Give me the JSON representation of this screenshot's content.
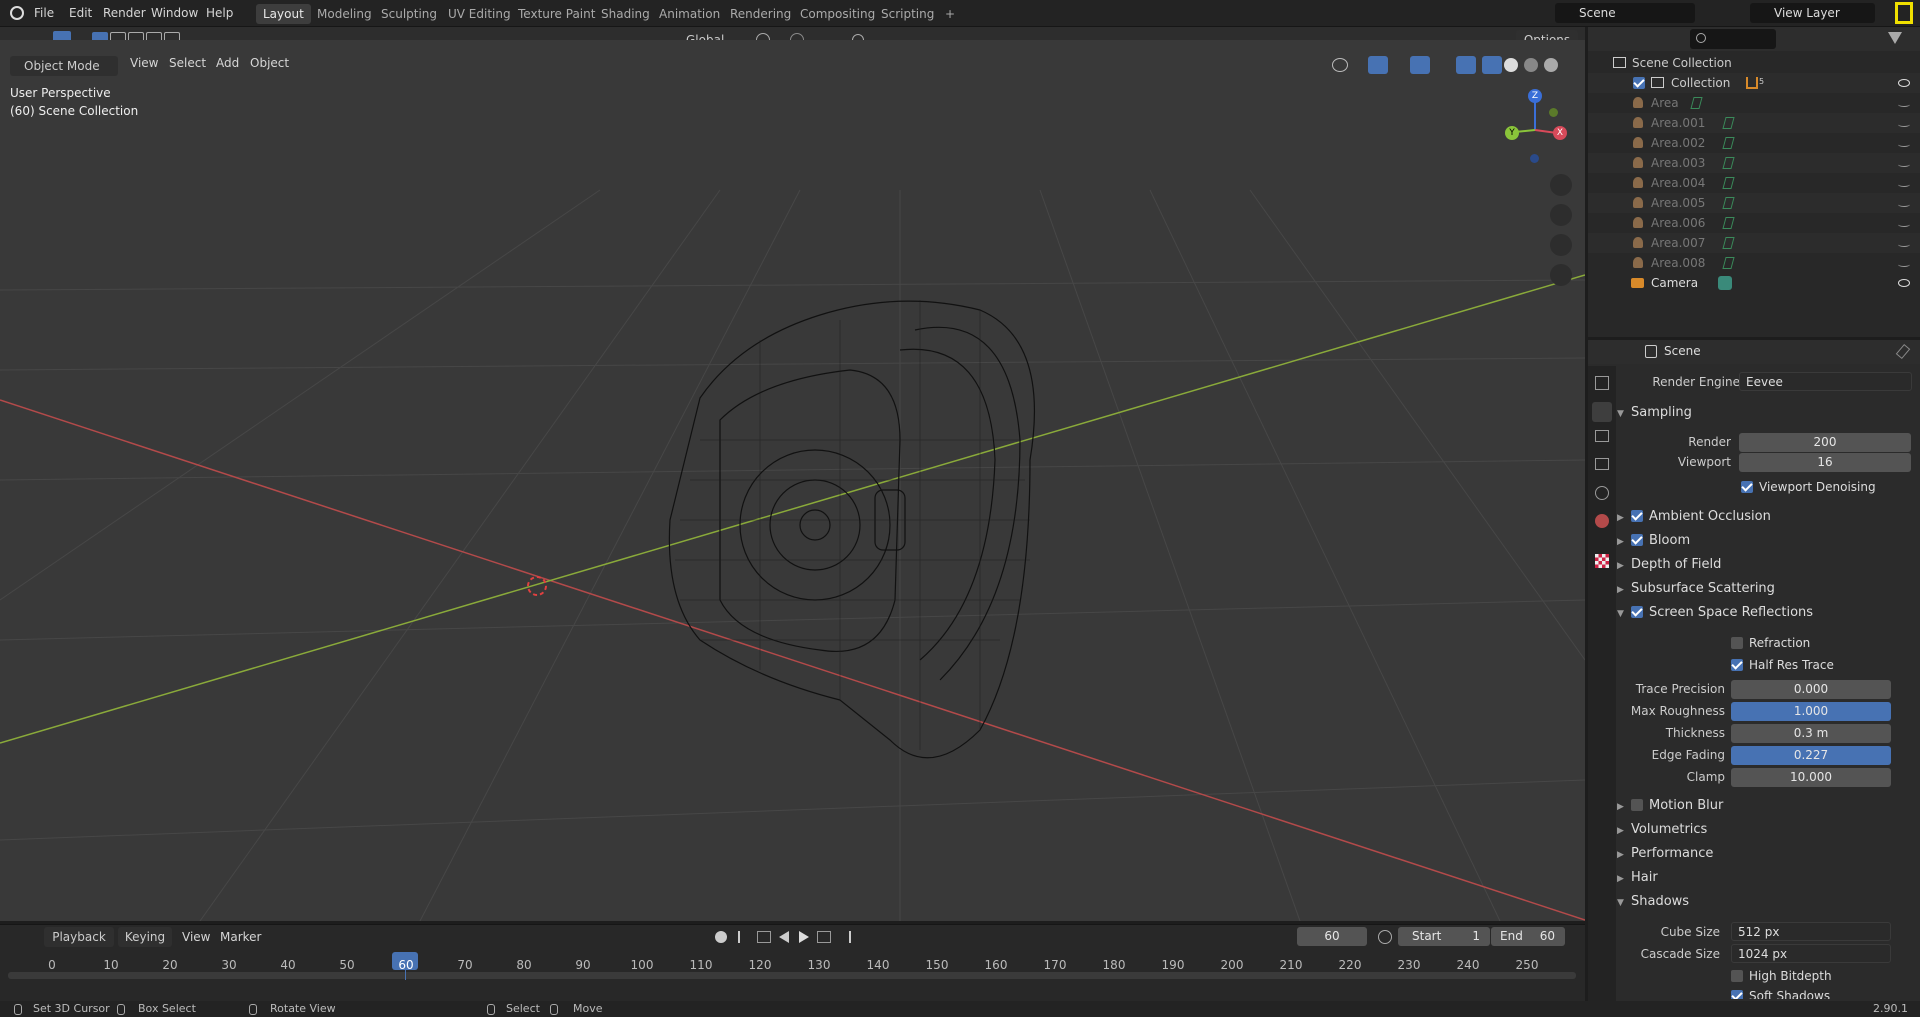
{
  "menus": [
    "File",
    "Edit",
    "Render",
    "Window",
    "Help"
  ],
  "workspaces": [
    "Layout",
    "Modeling",
    "Sculpting",
    "UV Editing",
    "Texture Paint",
    "Shading",
    "Animation",
    "Rendering",
    "Compositing",
    "Scripting"
  ],
  "scene_name": "Scene",
  "view_layer": "View Layer",
  "viewport": {
    "mode": "Object Mode",
    "menus": [
      "View",
      "Select",
      "Add",
      "Object"
    ],
    "transform_orientation": "Global",
    "options_label": "Options",
    "info_line1": "User Perspective",
    "info_line2": "(60) Scene Collection",
    "gizmo_z": "Z",
    "gizmo_y": "Y",
    "gizmo_x": "X"
  },
  "timeline": {
    "menus": [
      "Playback",
      "Keying",
      "View",
      "Marker"
    ],
    "current_frame": "60",
    "start_label": "Start",
    "start": "1",
    "end_label": "End",
    "end": "60",
    "ticks": [
      "0",
      "10",
      "20",
      "30",
      "40",
      "50",
      "60",
      "70",
      "80",
      "90",
      "100",
      "110",
      "120",
      "130",
      "140",
      "150",
      "160",
      "170",
      "180",
      "190",
      "200",
      "210",
      "220",
      "230",
      "240",
      "250"
    ]
  },
  "status": {
    "items": [
      "Set 3D Cursor",
      "Box Select",
      "Rotate View",
      "Select",
      "Move"
    ],
    "version": "2.90.1"
  },
  "outliner": {
    "root": "Scene Collection",
    "collection": "Collection",
    "collection_badge": "5",
    "items": [
      "Area",
      "Area.001",
      "Area.002",
      "Area.003",
      "Area.004",
      "Area.005",
      "Area.006",
      "Area.007",
      "Area.008"
    ],
    "camera": "Camera"
  },
  "properties": {
    "context": "Scene",
    "render_engine_label": "Render Engine",
    "render_engine": "Eevee",
    "sampling": "Sampling",
    "render_label": "Render",
    "render_value": "200",
    "viewport_label": "Viewport",
    "viewport_value": "16",
    "viewport_denoising": "Viewport Denoising",
    "panels_a": [
      "Ambient Occlusion",
      "Bloom",
      "Depth of Field",
      "Subsurface Scattering",
      "Screen Space Reflections"
    ],
    "refraction": "Refraction",
    "half_res": "Half Res Trace",
    "ssr_labels": [
      "Trace Precision",
      "Max Roughness",
      "Thickness",
      "Edge Fading",
      "Clamp"
    ],
    "ssr_values": [
      "0.000",
      "1.000",
      "0.3 m",
      "0.227",
      "10.000"
    ],
    "panels_b": [
      "Motion Blur",
      "Volumetrics",
      "Performance",
      "Hair",
      "Shadows"
    ],
    "cube_size_label": "Cube Size",
    "cube_size": "512 px",
    "cascade_size_label": "Cascade Size",
    "cascade_size": "1024 px",
    "high_bitdepth": "High Bitdepth",
    "soft_shadows": "Soft Shadows"
  },
  "colors": {
    "accent": "#4772b3",
    "x_axis": "#b34a4a",
    "y_axis": "#8aaa3a",
    "active_ws": "#3d3d3d"
  }
}
